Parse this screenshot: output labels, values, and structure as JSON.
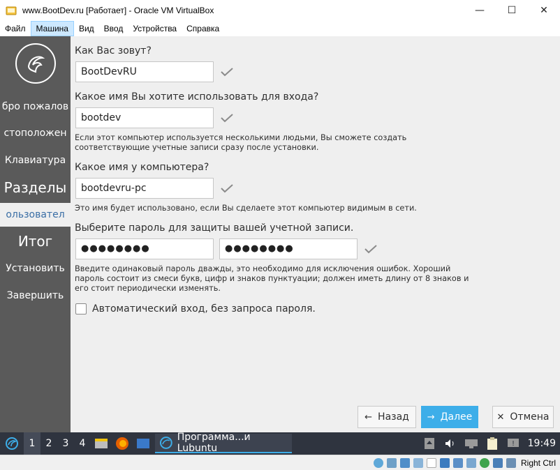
{
  "window": {
    "title": "www.BootDev.ru [Работает] - Oracle VM VirtualBox",
    "minimize": "—",
    "maximize": "☐",
    "close": "✕"
  },
  "menu": {
    "items": [
      "Файл",
      "Машина",
      "Вид",
      "Ввод",
      "Устройства",
      "Справка"
    ],
    "active": "Машина"
  },
  "sidebar": {
    "steps": [
      {
        "label": "Добро пожаловать",
        "shown": "бро пожалов"
      },
      {
        "label": "Местоположение",
        "shown": "стоположен"
      },
      {
        "label": "Клавиатура",
        "shown": "Клавиатура"
      },
      {
        "label": "Разделы",
        "shown": "Разделы"
      },
      {
        "label": "Пользователи",
        "shown": "ользовател"
      },
      {
        "label": "Итог",
        "shown": "Итог"
      },
      {
        "label": "Установить",
        "shown": "Установить"
      },
      {
        "label": "Завершить",
        "shown": "Завершить"
      }
    ],
    "current_index": 4
  },
  "form": {
    "name_question": "Как Вас зовут?",
    "name_value": "BootDevRU",
    "login_question": "Какое имя Вы хотите использовать для входа?",
    "login_value": "bootdev",
    "login_note": "Если этот компьютер используется несколькими людьми, Вы сможете создать соответствующие учетные записи сразу после установки.",
    "host_question": "Какое имя у компьютера?",
    "host_value": "bootdevru-pc",
    "host_note": "Это имя будет использовано, если Вы сделаете этот компьютер видимым в сети.",
    "password_question": "Выберите пароль для защиты вашей учетной записи.",
    "password_value": "●●●●●●●●",
    "password_confirm_value": "●●●●●●●●",
    "password_note": "Введите одинаковый пароль дважды, это необходимо для исключения ошибок. Хороший пароль состоит из смеси букв, цифр и знаков пунктуации; должен иметь длину от 8 знаков и его стоит периодически изменять.",
    "autologin_label": "Автоматический вход, без запроса пароля.",
    "autologin_checked": false
  },
  "buttons": {
    "back": "Назад",
    "next": "Далее",
    "cancel": "Отмена"
  },
  "taskbar": {
    "desktops": [
      "1",
      "2",
      "3",
      "4"
    ],
    "active_desktop": "1",
    "task_label": "Программа...и Lubuntu",
    "clock": "19:49"
  },
  "statusbar": {
    "host_key": "Right Ctrl"
  },
  "colors": {
    "accent": "#3daee9",
    "sidebar_bg": "#5a5a5a",
    "taskbar_bg": "#2f343f"
  }
}
